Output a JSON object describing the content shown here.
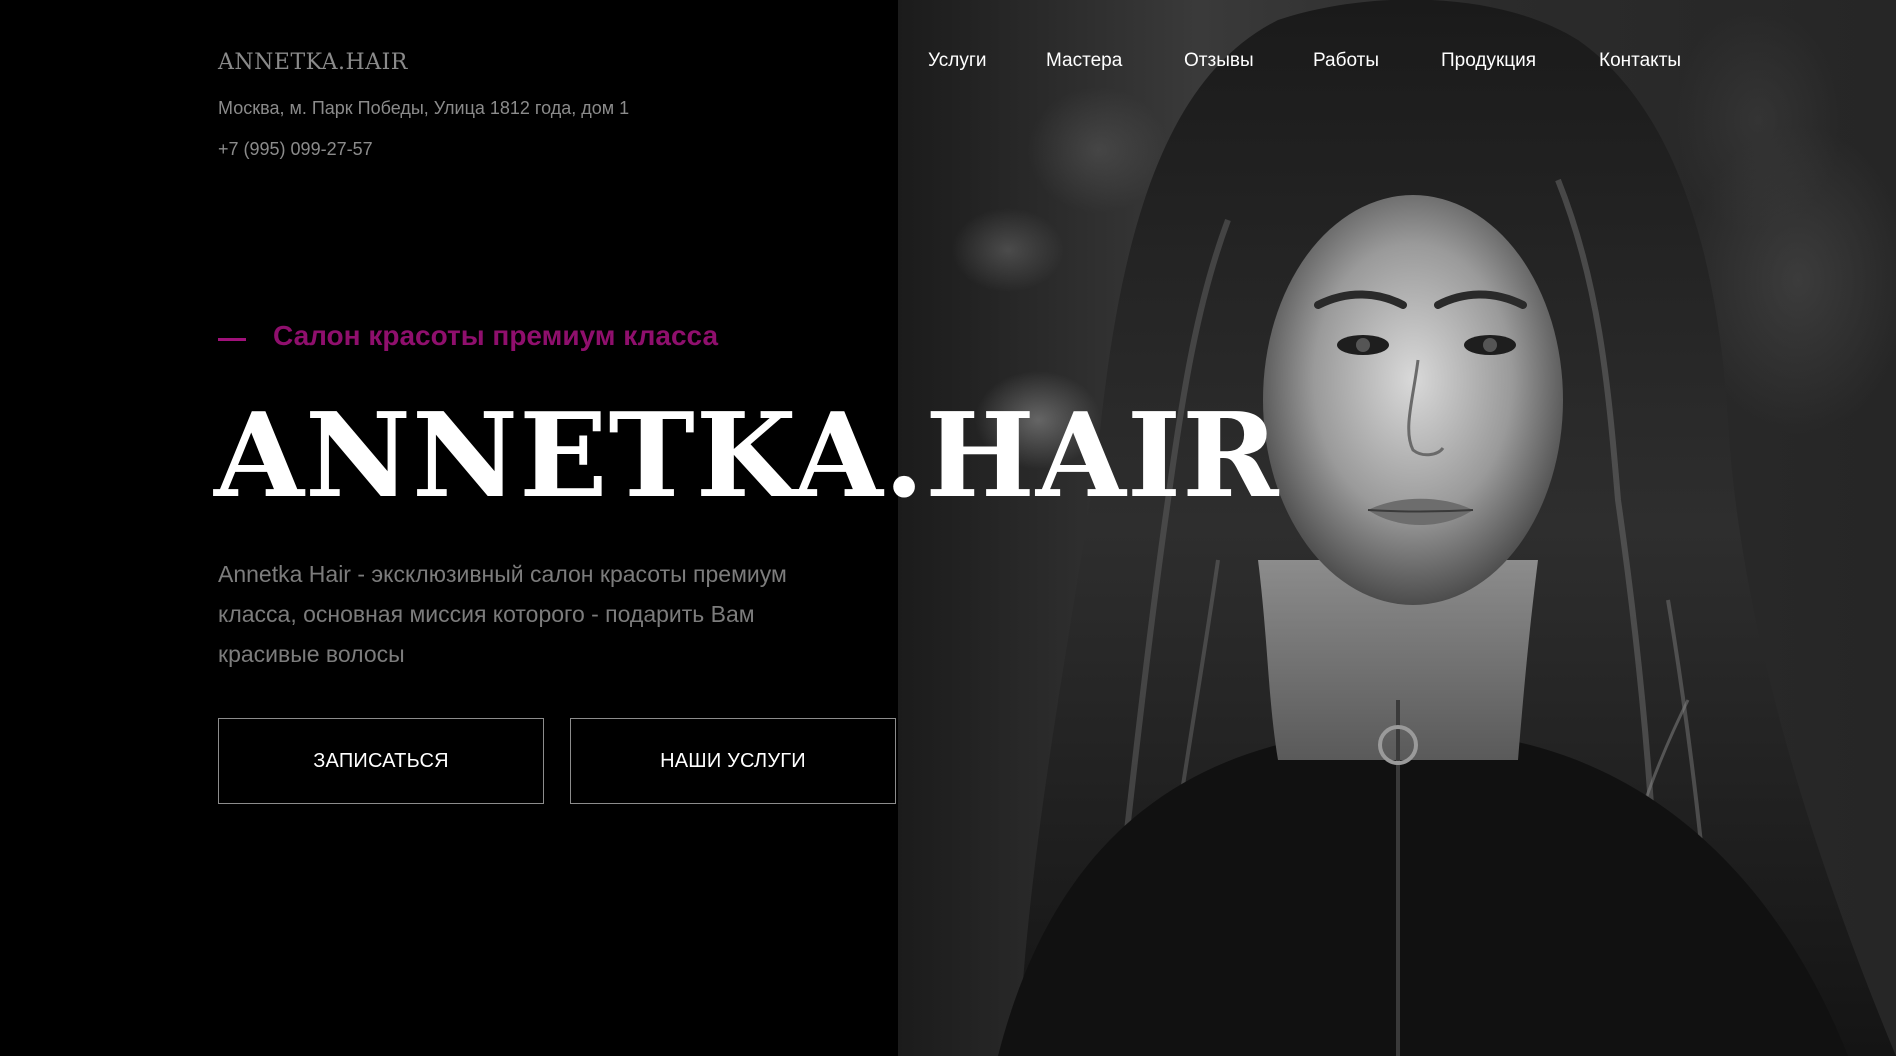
{
  "header": {
    "logo": "ANNETKA.HAIR",
    "address": "Москва, м. Парк Победы, Улица 1812 года, дом 1",
    "phone": "+7 (995) 099-27-57"
  },
  "nav": {
    "items": [
      {
        "label": "Услуги"
      },
      {
        "label": "Мастера"
      },
      {
        "label": "Отзывы"
      },
      {
        "label": "Работы"
      },
      {
        "label": "Продукция"
      },
      {
        "label": "Контакты"
      }
    ]
  },
  "hero": {
    "tagline": "Салон красоты премиум класса",
    "title": "ANNETKA.HAIR",
    "description": "Annetka Hair - эксклюзивный салон красоты премиум класса, основная миссия которого - подарить Вам красивые волосы",
    "buttons": {
      "book": "ЗАПИСАТЬСЯ",
      "services": "НАШИ УСЛУГИ"
    }
  },
  "colors": {
    "background": "#000000",
    "accent": "#8f0f6d",
    "text_primary": "#ffffff",
    "text_muted": "#7c7c7c"
  }
}
